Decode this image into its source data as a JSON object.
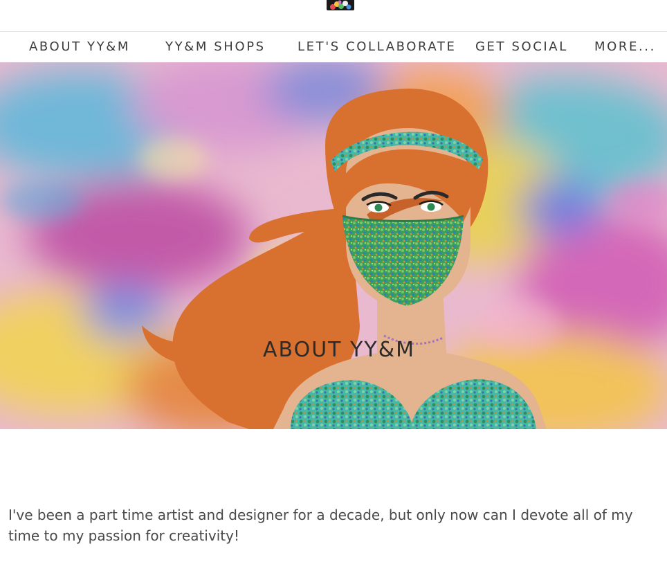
{
  "nav": {
    "items": [
      {
        "label": "ABOUT YY&M",
        "active": true
      },
      {
        "label": "YY&M SHOPS",
        "active": false
      },
      {
        "label": "LET'S COLLABORATE",
        "active": false
      },
      {
        "label": "GET SOCIAL",
        "active": false
      },
      {
        "label": "MORE...",
        "active": false
      }
    ]
  },
  "hero": {
    "title": "ABOUT YY&M"
  },
  "content": {
    "intro": "I've been a part time artist and designer for a decade, but only now can I devote all of my time to my passion for creativity!"
  },
  "colors": {
    "text": "#3c3c3c",
    "hair": "#d8712f",
    "skin": "#e3b48f",
    "mask": "#3aa060",
    "accent_teal": "#3fb3a5"
  }
}
